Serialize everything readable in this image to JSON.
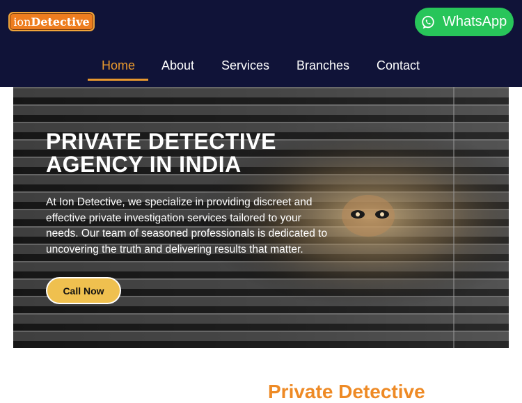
{
  "brand": {
    "logo_part1": "ion",
    "logo_part2": "Detective"
  },
  "whatsapp": {
    "label": "WhatsApp",
    "icon": "whatsapp-icon",
    "color": "#28c55a"
  },
  "nav": {
    "items": [
      {
        "label": "Home",
        "active": true
      },
      {
        "label": "About",
        "active": false
      },
      {
        "label": "Services",
        "active": false
      },
      {
        "label": "Branches",
        "active": false
      },
      {
        "label": "Contact",
        "active": false
      }
    ]
  },
  "hero": {
    "title_line1": "PRIVATE DETECTIVE",
    "title_line2": "AGENCY IN INDIA",
    "description": "At Ion Detective, we specialize in providing discreet and effective private investigation services tailored to your needs. Our team of seasoned professionals is dedicated to uncovering the truth and delivering results that matter.",
    "cta_label": "Call Now"
  },
  "section": {
    "heading": "Private Detective"
  },
  "colors": {
    "header_bg": "#101338",
    "accent": "#eb9a2d",
    "cta": "#efc04f"
  }
}
